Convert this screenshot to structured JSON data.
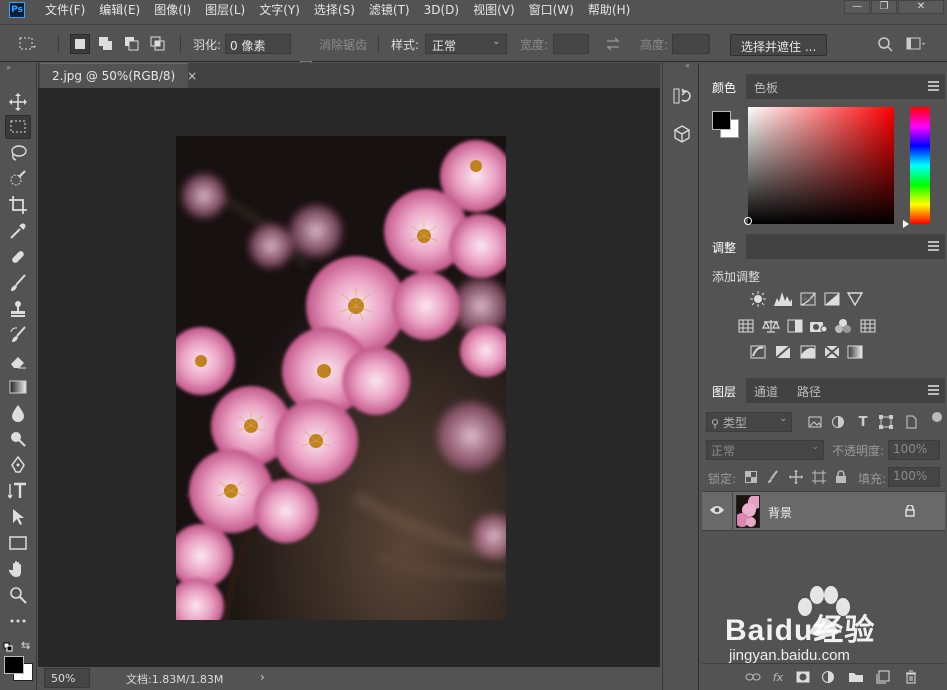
{
  "app": {
    "logo": "Ps"
  },
  "menu": [
    "文件(F)",
    "编辑(E)",
    "图像(I)",
    "图层(L)",
    "文字(Y)",
    "选择(S)",
    "滤镜(T)",
    "3D(D)",
    "视图(V)",
    "窗口(W)",
    "帮助(H)"
  ],
  "window_controls": {
    "minimize": "—",
    "restore": "❐",
    "close": "✕"
  },
  "options": {
    "feather_label": "羽化:",
    "feather_value": "0 像素",
    "antialias_label": "消除锯齿",
    "style_label": "样式:",
    "style_value": "正常",
    "width_label": "宽度:",
    "height_label": "高度:",
    "select_mask_button": "选择并遮住 ..."
  },
  "document": {
    "tab_title": "2.jpg @ 50%(RGB/8)",
    "close_glyph": "×",
    "zoom": "50%",
    "doc_info": "文档:1.83M/1.83M",
    "status_arrow": "›"
  },
  "panels": {
    "color": {
      "tabs": [
        "颜色",
        "色板"
      ],
      "foreground": "#000000",
      "background": "#ffffff"
    },
    "adjustments": {
      "tab": "调整",
      "subtitle": "添加调整"
    },
    "layers": {
      "tabs": [
        "图层",
        "通道",
        "路径"
      ],
      "filter_label": "类型",
      "blend_mode": "正常",
      "opacity_label": "不透明度:",
      "opacity_value": "100%",
      "lock_label": "锁定:",
      "fill_label": "填充:",
      "fill_value": "100%",
      "layer_name": "背景"
    }
  },
  "toolbar_swatches": {
    "foreground": "#000000",
    "background": "#ffffff"
  },
  "watermark": {
    "brand": "Baidu经验",
    "url": "jingyan.baidu.com"
  },
  "colors": {
    "ui_bg": "#535353",
    "canvas_bg": "#282828",
    "panel_tab_bg": "#424242",
    "accent_blue": "#31a8ff"
  }
}
